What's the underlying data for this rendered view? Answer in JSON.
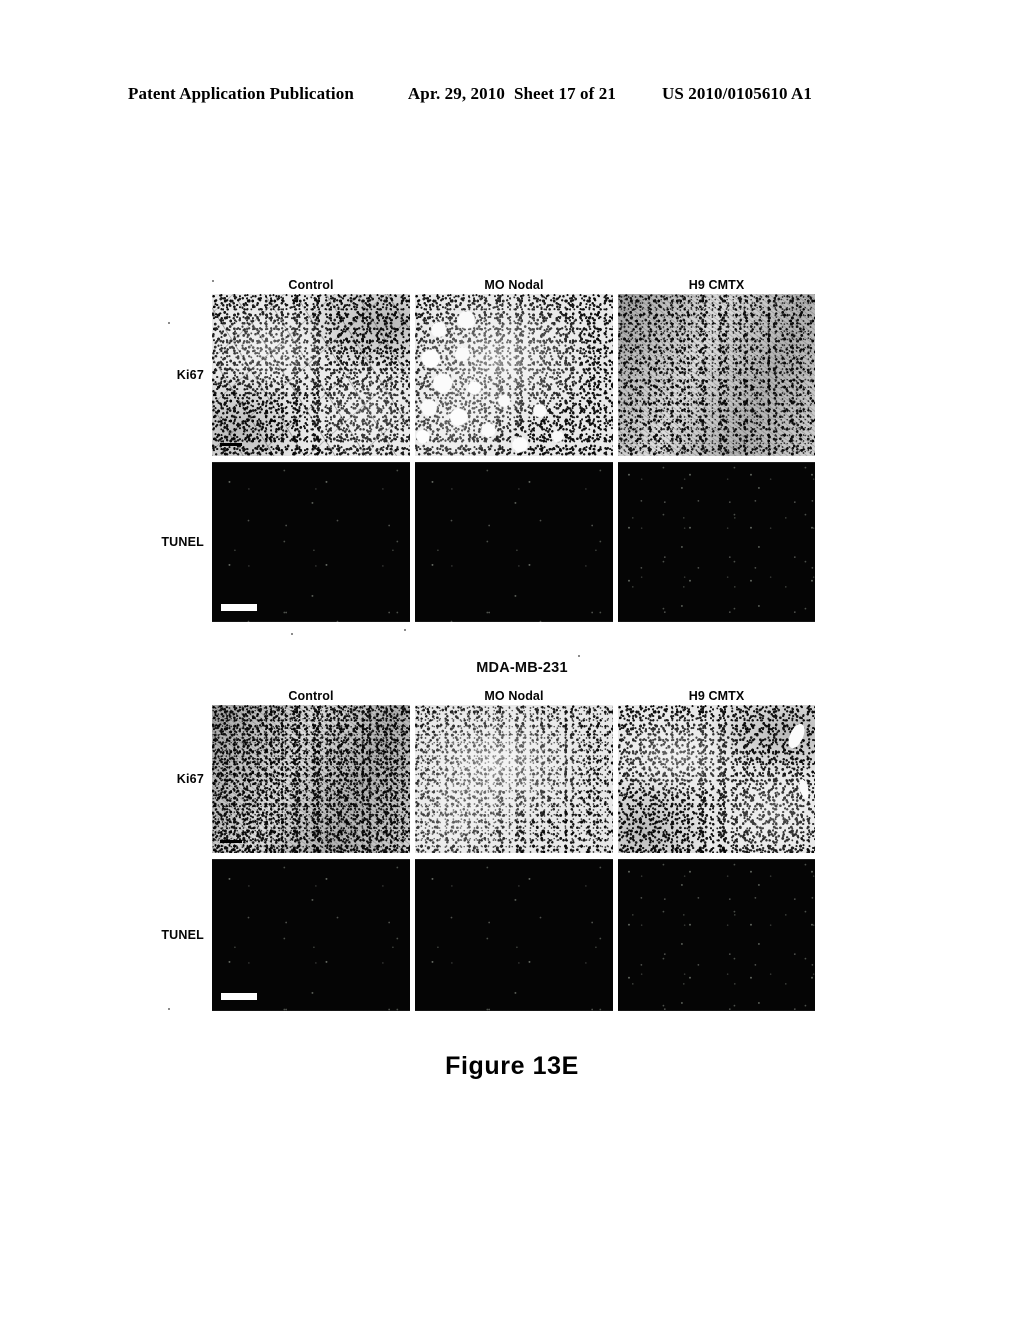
{
  "header": {
    "publication": "Patent Application Publication",
    "date": "Apr. 29, 2010",
    "sheet": "Sheet 17 of 21",
    "patent_number": "US 2010/0105610 A1"
  },
  "figure": {
    "caption": "Figure 13E",
    "panel_groups": [
      {
        "id": "group-a",
        "title": "",
        "column_headers": [
          "Control",
          "MO Nodal",
          "H9 CMTX"
        ],
        "rows": [
          {
            "label": "Ki67",
            "panels": [
              {
                "condition": "Control",
                "stain": "Ki67",
                "appearance": "dense speckled histology, dark diagonal stromal band upper right"
              },
              {
                "condition": "MO Nodal",
                "stain": "Ki67",
                "appearance": "speckled histology with cluster of large white round vacuoles at left"
              },
              {
                "condition": "H9 CMTX",
                "stain": "Ki67",
                "appearance": "dark dense uniform speckled histology"
              }
            ]
          },
          {
            "label": "TUNEL",
            "panels": [
              {
                "condition": "Control",
                "stain": "TUNEL",
                "appearance": "near-black field, very few bright nuclei",
                "scale_bar": true
              },
              {
                "condition": "MO Nodal",
                "stain": "TUNEL",
                "appearance": "near-black field, very few bright nuclei",
                "scale_bar": false
              },
              {
                "condition": "H9 CMTX",
                "stain": "TUNEL",
                "appearance": "near-black field, scattered bright nuclei",
                "scale_bar": false
              }
            ]
          }
        ]
      },
      {
        "id": "group-b",
        "title": "MDA-MB-231",
        "column_headers": [
          "Control",
          "MO Nodal",
          "H9 CMTX"
        ],
        "rows": [
          {
            "label": "Ki67",
            "panels": [
              {
                "condition": "Control",
                "stain": "Ki67",
                "appearance": "dense dark speckled histology with scattered large dark nuclei"
              },
              {
                "condition": "MO Nodal",
                "stain": "Ki67",
                "appearance": "lighter sparser speckled histology"
              },
              {
                "condition": "H9 CMTX",
                "stain": "Ki67",
                "appearance": "dense speckled histology with white vessel lumen upper right"
              }
            ]
          },
          {
            "label": "TUNEL",
            "panels": [
              {
                "condition": "Control",
                "stain": "TUNEL",
                "appearance": "near-black field, sparse bright nuclei",
                "scale_bar": true
              },
              {
                "condition": "MO Nodal",
                "stain": "TUNEL",
                "appearance": "near-black field, sparse bright nuclei",
                "scale_bar": false
              },
              {
                "condition": "H9 CMTX",
                "stain": "TUNEL",
                "appearance": "near-black field, scattered bright nuclei",
                "scale_bar": false
              }
            ]
          }
        ]
      }
    ]
  },
  "colors": {
    "page_background": "#ffffff",
    "text": "#000000",
    "tunel_field": "#050505",
    "scale_bar": "#ffffff"
  }
}
